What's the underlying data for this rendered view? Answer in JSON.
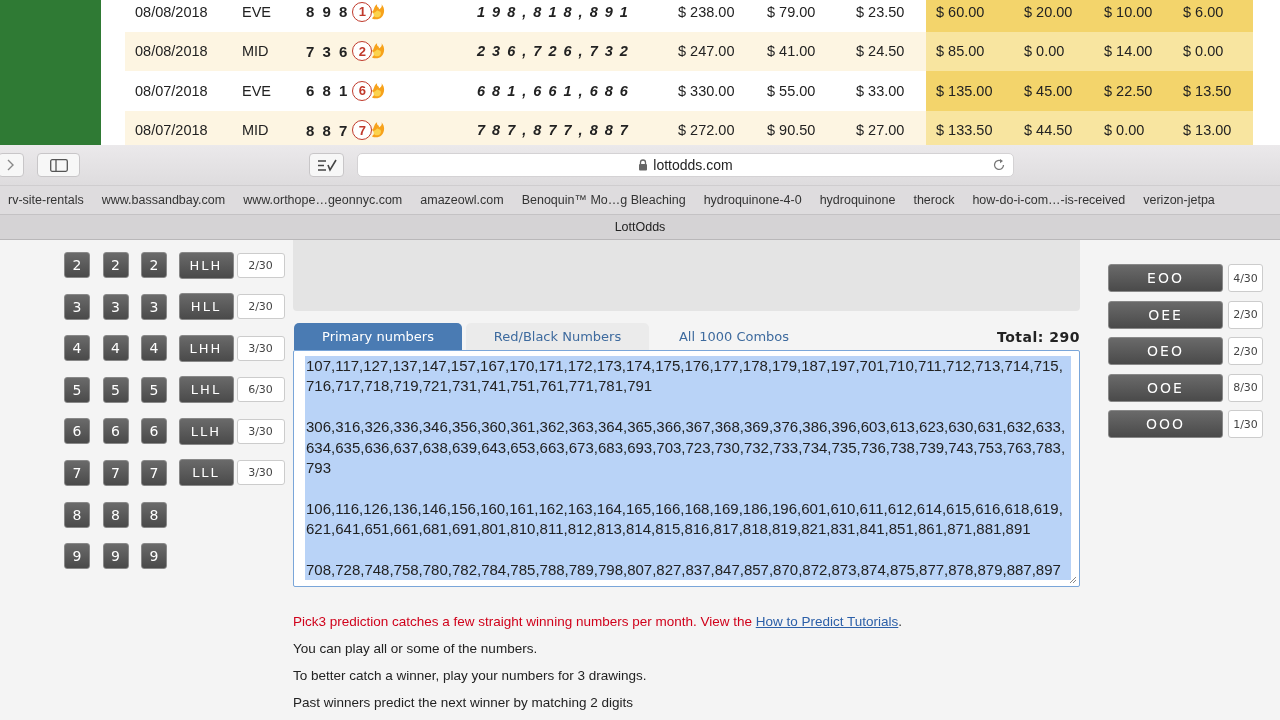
{
  "results": {
    "rows": [
      {
        "date": "08/08/2018",
        "draw": "EVE",
        "number": "8 9 8",
        "hit": "1",
        "combos": "1 9 8 , 8 1 8 , 8 9 1",
        "amounts": [
          {
            "text": "$ 238.00",
            "highlight": false
          },
          {
            "text": "$ 79.00",
            "highlight": false
          },
          {
            "text": "$ 23.50",
            "highlight": false
          },
          {
            "text": "$ 60.00",
            "highlight": true
          },
          {
            "text": "$ 20.00",
            "highlight": true
          },
          {
            "text": "$ 10.00",
            "highlight": true
          },
          {
            "text": "$ 6.00",
            "highlight": true
          }
        ]
      },
      {
        "date": "08/08/2018",
        "draw": "MID",
        "number": "7 3 6",
        "hit": "2",
        "combos": "2 3 6 , 7 2 6 , 7 3 2",
        "amounts": [
          {
            "text": "$ 247.00",
            "highlight": false
          },
          {
            "text": "$ 41.00",
            "highlight": false
          },
          {
            "text": "$ 24.50",
            "highlight": false
          },
          {
            "text": "$ 85.00",
            "highlight": true
          },
          {
            "text": "$ 0.00",
            "highlight": true
          },
          {
            "text": "$ 14.00",
            "highlight": true
          },
          {
            "text": "$ 0.00",
            "highlight": true
          }
        ]
      },
      {
        "date": "08/07/2018",
        "draw": "EVE",
        "number": "6 8 1",
        "hit": "6",
        "combos": "6 8 1 , 6 6 1 , 6 8 6",
        "amounts": [
          {
            "text": "$ 330.00",
            "highlight": false
          },
          {
            "text": "$ 55.00",
            "highlight": false
          },
          {
            "text": "$ 33.00",
            "highlight": false
          },
          {
            "text": "$ 135.00",
            "highlight": true
          },
          {
            "text": "$ 45.00",
            "highlight": true
          },
          {
            "text": "$ 22.50",
            "highlight": true
          },
          {
            "text": "$ 13.50",
            "highlight": true
          }
        ]
      },
      {
        "date": "08/07/2018",
        "draw": "MID",
        "number": "8 8 7",
        "hit": "7",
        "combos": "7 8 7 , 8 7 7 , 8 8 7",
        "amounts": [
          {
            "text": "$ 272.00",
            "highlight": false
          },
          {
            "text": "$ 90.50",
            "highlight": false
          },
          {
            "text": "$ 27.00",
            "highlight": false
          },
          {
            "text": "$ 133.50",
            "highlight": true
          },
          {
            "text": "$ 44.50",
            "highlight": true
          },
          {
            "text": "$ 0.00",
            "highlight": true
          },
          {
            "text": "$ 13.00",
            "highlight": true
          }
        ]
      }
    ]
  },
  "browser": {
    "url": "lottodds.com",
    "bookmarks": [
      "rv-site-rentals",
      "www.bassandbay.com",
      "www.orthope…geonnyc.com",
      "amazeowl.com",
      "Benoquin™ Mo…g Bleaching",
      "hydroquinone-4-0",
      "hydroquinone",
      "therock",
      "how-do-i-com…-is-received",
      "verizon-jetpa"
    ],
    "tab_title": "LottOdds"
  },
  "digit_rows": [
    {
      "digits": [
        "2",
        "2",
        "2"
      ],
      "pattern": "HLH",
      "count": "2/30"
    },
    {
      "digits": [
        "3",
        "3",
        "3"
      ],
      "pattern": "HLL",
      "count": "2/30"
    },
    {
      "digits": [
        "4",
        "4",
        "4"
      ],
      "pattern": "LHH",
      "count": "3/30"
    },
    {
      "digits": [
        "5",
        "5",
        "5"
      ],
      "pattern": "LHL",
      "count": "6/30"
    },
    {
      "digits": [
        "6",
        "6",
        "6"
      ],
      "pattern": "LLH",
      "count": "3/30"
    },
    {
      "digits": [
        "7",
        "7",
        "7"
      ],
      "pattern": "LLL",
      "count": "3/30"
    },
    {
      "digits": [
        "8",
        "8",
        "8"
      ]
    },
    {
      "digits": [
        "9",
        "9",
        "9"
      ]
    }
  ],
  "tabs": [
    {
      "label": "Primary numbers",
      "selected": true
    },
    {
      "label": "Red/Black Numbers",
      "selected": false
    },
    {
      "label": "All 1000 Combos",
      "selected": false
    }
  ],
  "total": "Total: 290",
  "numbers": {
    "selected": true,
    "groups": [
      "107,117,127,137,147,157,167,170,171,172,173,174,175,176,177,178,179,187,197,701,710,711,712,713,714,715,716,717,718,719,721,731,741,751,761,771,781,791",
      "306,316,326,336,346,356,360,361,362,363,364,365,366,367,368,369,376,386,396,603,613,623,630,631,632,633,634,635,636,637,638,639,643,653,663,673,683,693,703,723,730,732,733,734,735,736,738,739,743,753,763,783,793",
      "106,116,126,136,146,156,160,161,162,163,164,165,166,168,169,186,196,601,610,611,612,614,615,616,618,619,621,641,651,661,681,691,801,810,811,812,813,814,815,816,817,818,819,821,831,841,851,861,871,881,891",
      "708,728,748,758,780,782,784,785,788,789,798,807,827,837,847,857,870,872,873,874,875,877,878,879,887,897"
    ]
  },
  "patterns": [
    {
      "label": "EOO",
      "count": "4/30"
    },
    {
      "label": "OEE",
      "count": "2/30"
    },
    {
      "label": "OEO",
      "count": "2/30"
    },
    {
      "label": "OOE",
      "count": "8/30"
    },
    {
      "label": "OOO",
      "count": "1/30"
    }
  ],
  "notice": {
    "text": "Pick3 prediction catches a few straight winning numbers per month. View the ",
    "link": "How to Predict Tutorials",
    "after": "."
  },
  "notes": [
    "You can play all or some of the numbers.",
    "To better catch a winner, play your numbers for 3 drawings.",
    "Past winners predict the next winner by matching 2 digits"
  ]
}
